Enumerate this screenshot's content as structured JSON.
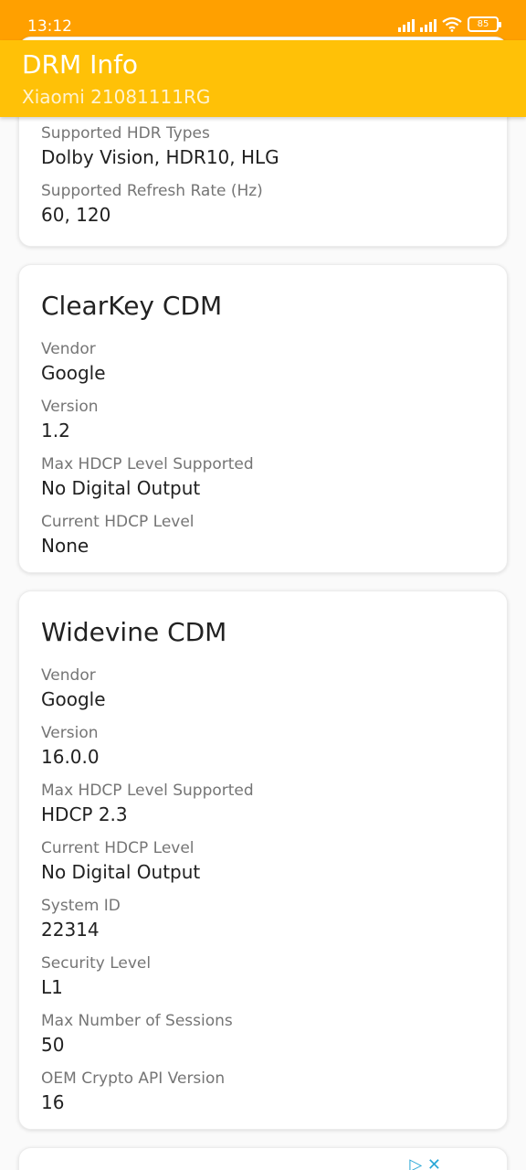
{
  "status_bar": {
    "time": "13:12",
    "battery": "85"
  },
  "app_bar": {
    "title": "DRM Info",
    "subtitle": "Xiaomi 21081111RG"
  },
  "display_card": {
    "fields": [
      {
        "label": "Supported HDR Types",
        "value": "Dolby Vision, HDR10, HLG"
      },
      {
        "label": "Supported Refresh Rate (Hz)",
        "value": "60, 120"
      }
    ]
  },
  "clearkey_card": {
    "title": "ClearKey CDM",
    "fields": [
      {
        "label": "Vendor",
        "value": "Google"
      },
      {
        "label": "Version",
        "value": "1.2"
      },
      {
        "label": "Max HDCP Level Supported",
        "value": "No Digital Output"
      },
      {
        "label": "Current HDCP Level",
        "value": "None"
      }
    ]
  },
  "widevine_card": {
    "title": "Widevine CDM",
    "fields": [
      {
        "label": "Vendor",
        "value": "Google"
      },
      {
        "label": "Version",
        "value": "16.0.0"
      },
      {
        "label": "Max HDCP Level Supported",
        "value": "HDCP 2.3"
      },
      {
        "label": "Current HDCP Level",
        "value": "No Digital Output"
      },
      {
        "label": "System ID",
        "value": "22314"
      },
      {
        "label": "Security Level",
        "value": "L1"
      },
      {
        "label": "Max Number of Sessions",
        "value": "50"
      },
      {
        "label": "OEM Crypto API Version",
        "value": "16"
      }
    ]
  },
  "icons": {
    "signal": "signal-bars-icon",
    "wifi": "wifi-icon",
    "battery": "battery-icon",
    "ad_choices": "ad-choices-icon",
    "ad_close": "close-icon"
  },
  "colors": {
    "status_bar": "#ffa000",
    "app_bar": "#ffc107",
    "ad_icon": "#2aa7d6"
  }
}
